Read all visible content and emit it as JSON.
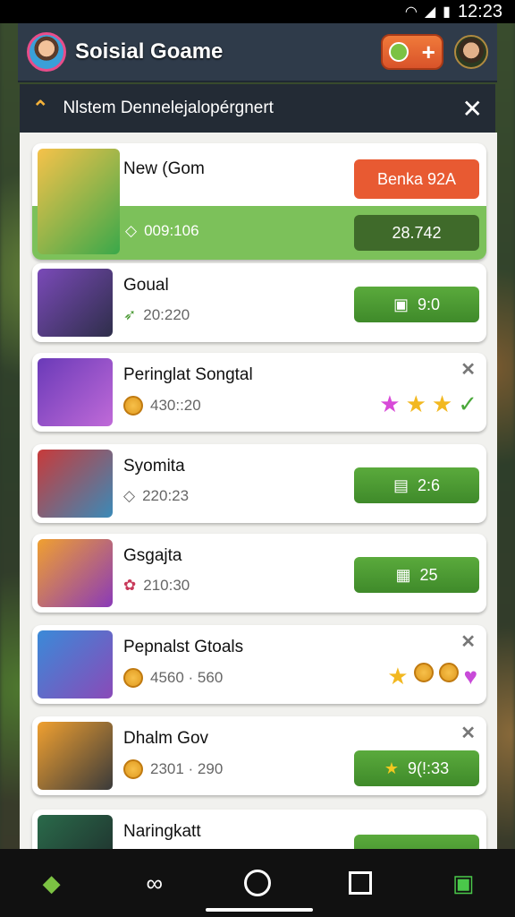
{
  "status": {
    "time": "12:23"
  },
  "header": {
    "title": "Soisial Goame",
    "add_label": "+"
  },
  "notification": {
    "text": "Nlstem Dennelejalopérgnert"
  },
  "cards": [
    {
      "title": "New (Gom",
      "sub": "009:106",
      "btn": "Benka 92A",
      "btn2": "28.742"
    },
    {
      "title": "Goual",
      "sub": "20:220",
      "btn": "9:0"
    },
    {
      "title": "Peringlat Songtal",
      "sub": "430::20"
    },
    {
      "title": "Syomita",
      "sub": "220:23",
      "btn": "2:6"
    },
    {
      "title": "Gsgajta",
      "sub": "210:30",
      "btn": "25"
    },
    {
      "title": "Pepnalst Gtoals",
      "sub": "4560 · 560"
    },
    {
      "title": "Dhalm Gov",
      "sub": "2301 · 290",
      "btn": "9(!:33"
    },
    {
      "title": "Naringkatt"
    }
  ],
  "colors": {
    "accent": "#e85a32",
    "green": "#4a9a34",
    "header": "#2f3b4a"
  },
  "icons": [
    "wifi-icon",
    "signal-icon",
    "battery-icon",
    "warning-icon",
    "close-icon",
    "star-icon",
    "check-icon",
    "coin-icon"
  ]
}
